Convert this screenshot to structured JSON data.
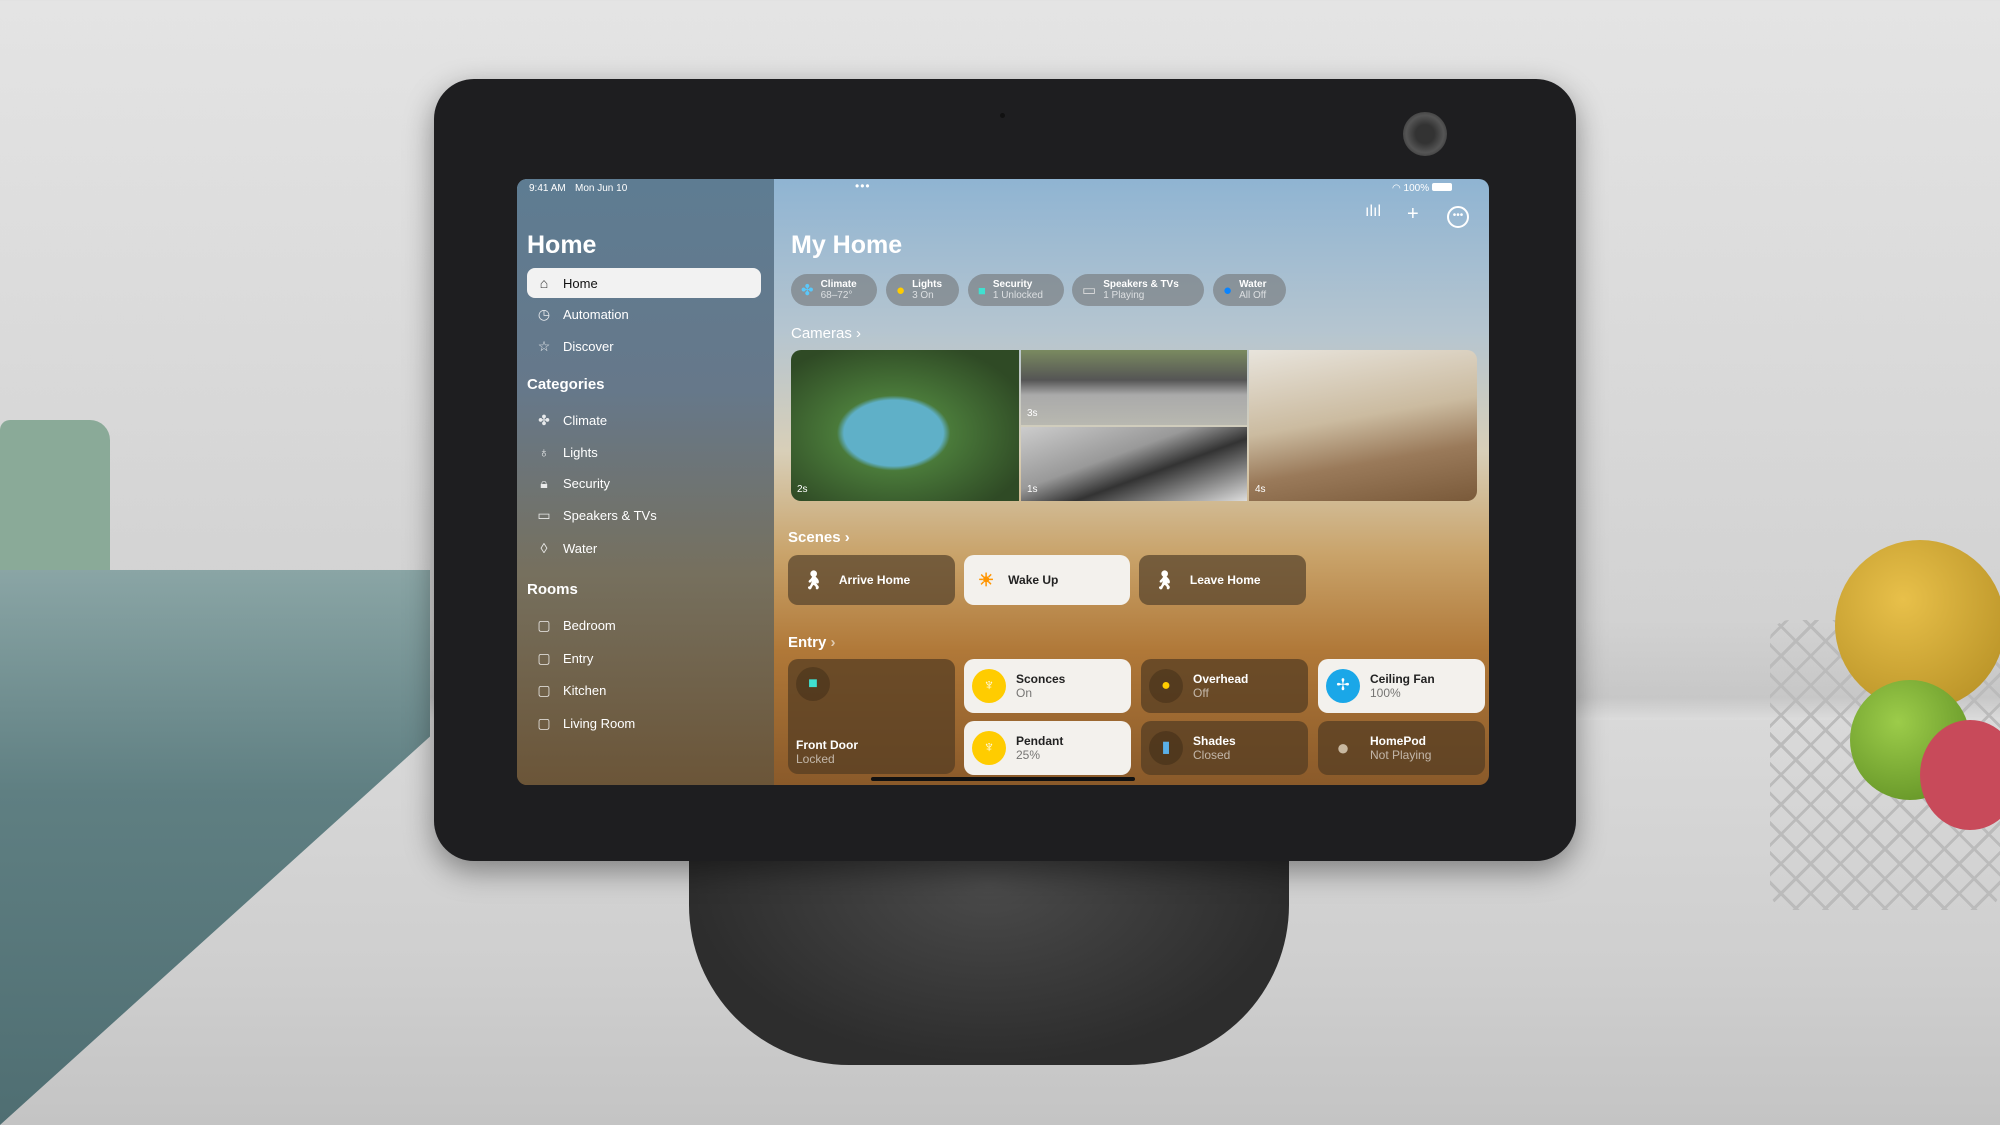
{
  "status": {
    "time": "9:41 AM",
    "date": "Mon Jun 10",
    "battery": "100%"
  },
  "sidebar": {
    "title": "Home",
    "nav": [
      {
        "label": "Home",
        "icon": "house-icon"
      },
      {
        "label": "Automation",
        "icon": "clock-check-icon"
      },
      {
        "label": "Discover",
        "icon": "star-icon"
      }
    ],
    "categories_title": "Categories",
    "categories": [
      {
        "label": "Climate",
        "icon": "fan-icon"
      },
      {
        "label": "Lights",
        "icon": "bulb-icon"
      },
      {
        "label": "Security",
        "icon": "lock-icon"
      },
      {
        "label": "Speakers & TVs",
        "icon": "tv-speaker-icon"
      },
      {
        "label": "Water",
        "icon": "drop-icon"
      }
    ],
    "rooms_title": "Rooms",
    "rooms": [
      {
        "label": "Bedroom"
      },
      {
        "label": "Entry"
      },
      {
        "label": "Kitchen"
      },
      {
        "label": "Living Room"
      }
    ]
  },
  "main": {
    "title": "My Home",
    "pills": [
      {
        "label": "Climate",
        "status": "68–72°",
        "color": "#5ac8fa"
      },
      {
        "label": "Lights",
        "status": "3 On",
        "color": "#ffcc00"
      },
      {
        "label": "Security",
        "status": "1 Unlocked",
        "color": "#40e0d0"
      },
      {
        "label": "Speakers & TVs",
        "status": "1 Playing",
        "color": "#dddddd"
      },
      {
        "label": "Water",
        "status": "All Off",
        "color": "#0a84ff"
      }
    ],
    "cameras_label": "Cameras",
    "cameras": [
      {
        "label": "2s"
      },
      {
        "label": "3s"
      },
      {
        "label": "1s"
      },
      {
        "label": "4s"
      }
    ],
    "scenes_label": "Scenes",
    "scenes": [
      {
        "label": "Arrive Home",
        "active": false
      },
      {
        "label": "Wake Up",
        "active": true
      },
      {
        "label": "Leave Home",
        "active": false
      }
    ],
    "entry_label": "Entry",
    "accessories": [
      {
        "name": "Front Door",
        "status": "Locked"
      },
      {
        "name": "Sconces",
        "status": "On"
      },
      {
        "name": "Overhead",
        "status": "Off"
      },
      {
        "name": "Ceiling Fan",
        "status": "100%"
      },
      {
        "name": "Pendant",
        "status": "25%"
      },
      {
        "name": "Shades",
        "status": "Closed"
      },
      {
        "name": "HomePod",
        "status": "Not Playing"
      }
    ]
  }
}
